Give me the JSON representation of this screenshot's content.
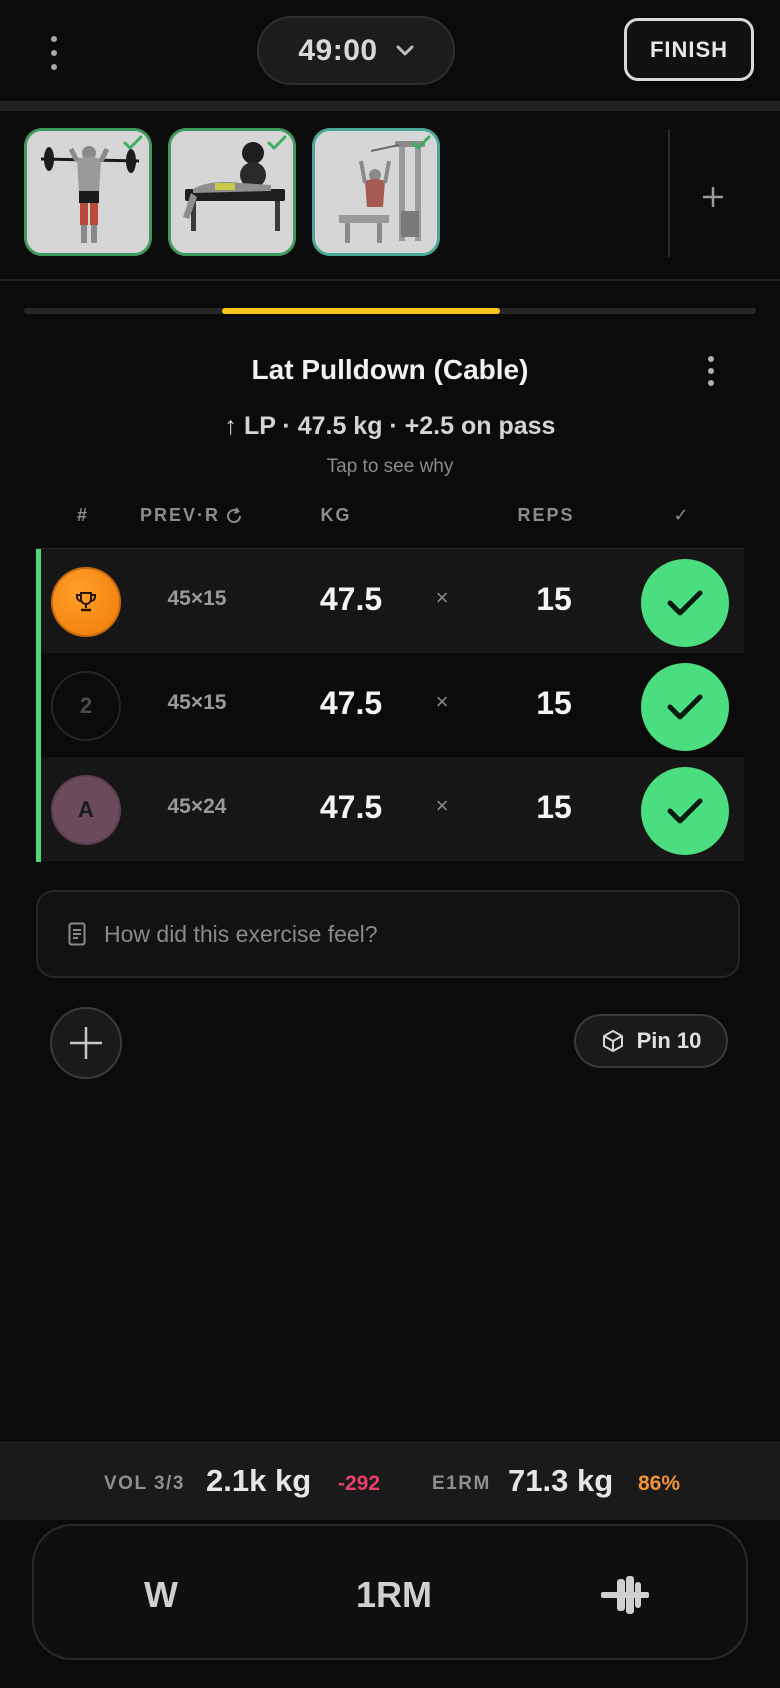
{
  "header": {
    "timer": "49:00",
    "finish_label": "FINISH"
  },
  "exercise_strip": {
    "thumbnails": [
      {
        "name": "Overhead press (barbell)",
        "completed": true
      },
      {
        "name": "Bench press (barbell)",
        "completed": true
      },
      {
        "name": "Lat Pulldown (Cable)",
        "completed": true,
        "active": true
      }
    ]
  },
  "progress": {
    "start_fraction": 0.27,
    "fill_fraction": 0.38,
    "color": "#f5c51b"
  },
  "exercise": {
    "title": "Lat Pulldown (Cable)",
    "progression": "↑ LP · 47.5 kg · +2.5 on pass",
    "hint": "Tap to see why"
  },
  "table": {
    "headers": {
      "index": "#",
      "prev": "PREV·R",
      "kg": "KG",
      "reps": "REPS",
      "done": "✓"
    },
    "times_symbol": "×",
    "sets": [
      {
        "marker": "",
        "marker_type": "trophy",
        "prev": "45×15",
        "kg": "47.5",
        "reps": "15",
        "done": true
      },
      {
        "marker": "2",
        "marker_type": "plain",
        "prev": "45×15",
        "kg": "47.5",
        "reps": "15",
        "done": true
      },
      {
        "marker": "A",
        "marker_type": "amrap",
        "prev": "45×24",
        "kg": "47.5",
        "reps": "15",
        "done": true
      }
    ]
  },
  "notes": {
    "placeholder": "How did this exercise feel?"
  },
  "pin": {
    "label": "Pin 10"
  },
  "stats": {
    "vol_label": "VOL 3/3",
    "vol_value": "2.1k kg",
    "vol_delta": "-292",
    "e1rm_label": "E1RM",
    "e1rm_value": "71.3 kg",
    "e1rm_percent": "86%",
    "colors": {
      "negative": "#e8406a",
      "warning": "#f2933a"
    }
  },
  "toolbar": {
    "warmup_label": "W",
    "one_rm_label": "1RM",
    "plates_icon": "barbell-plates-icon"
  },
  "colors": {
    "accent_green": "#4ade80",
    "trophy_orange": "#f5870e",
    "amrap_mauve": "#6b4a5c"
  }
}
